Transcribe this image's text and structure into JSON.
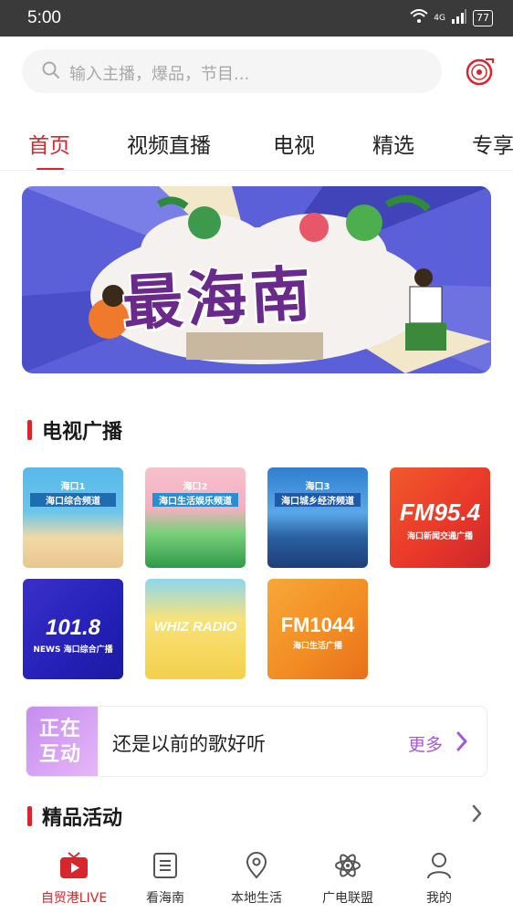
{
  "status_bar": {
    "time": "5:00",
    "network": "4G",
    "battery": "77"
  },
  "search": {
    "placeholder": "输入主播，爆品，节目..."
  },
  "icons": {
    "search": "search-icon",
    "record": "vinyl-record-icon"
  },
  "tabs": [
    {
      "label": "首页",
      "active": true
    },
    {
      "label": "视频直播",
      "active": false
    },
    {
      "label": "电视",
      "active": false
    },
    {
      "label": "精选",
      "active": false
    },
    {
      "label": "专享",
      "active": false
    }
  ],
  "banner": {
    "title": "最海南"
  },
  "tv_section": {
    "title": "电视广播"
  },
  "channels": [
    {
      "logo": "海口1",
      "name": "海口综合频道",
      "color": "#3aa0d8"
    },
    {
      "logo": "海口2",
      "name": "海口生活娱乐频道",
      "color": "#f0a8b8"
    },
    {
      "logo": "海口3",
      "name": "海口城乡经济频道",
      "color": "#3e8fd6"
    },
    {
      "logo": "FM95.4",
      "name": "海口新闻交通广播",
      "color": "#e8452e"
    },
    {
      "logo": "101.8",
      "name": "NEWS 海口综合广播",
      "color": "#2b2fd4"
    },
    {
      "logo": "WHIZ RADIO",
      "name": "",
      "color": "#f6d44a"
    },
    {
      "logo": "FM1044",
      "name": "海口生活广播",
      "color": "#f29a2b"
    }
  ],
  "interact": {
    "badge_line1": "正在",
    "badge_line2": "互动",
    "text": "还是以前的歌好听",
    "more": "更多"
  },
  "activities_section": {
    "title": "精品活动"
  },
  "bottom_nav": [
    {
      "label": "自贸港LIVE",
      "icon": "tv-icon",
      "active": true
    },
    {
      "label": "看海南",
      "icon": "list-icon",
      "active": false
    },
    {
      "label": "本地生活",
      "icon": "location-pin-icon",
      "active": false
    },
    {
      "label": "广电联盟",
      "icon": "atom-icon",
      "active": false
    },
    {
      "label": "我的",
      "icon": "user-icon",
      "active": false
    }
  ],
  "colors": {
    "accent": "#d8262c",
    "interact": "#a35ad6"
  }
}
